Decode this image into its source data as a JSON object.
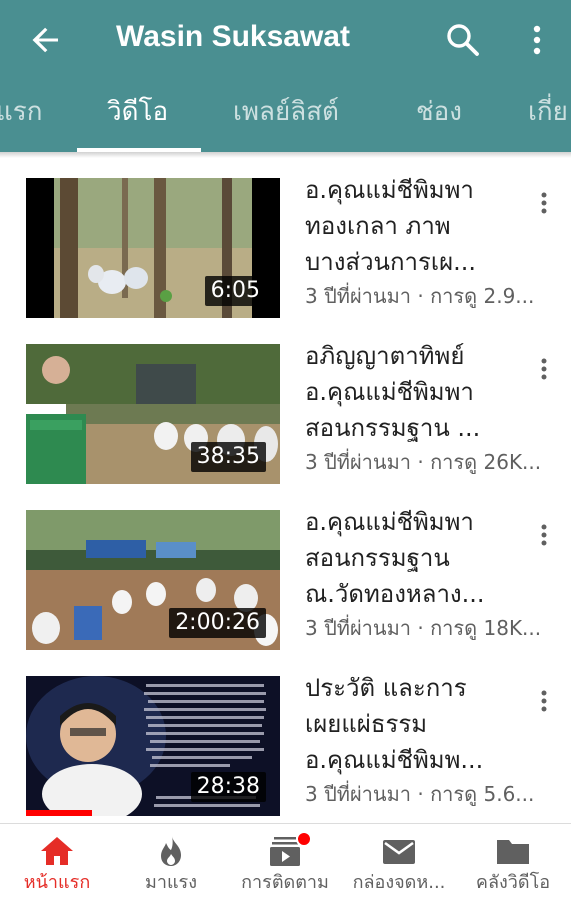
{
  "header": {
    "title": "Wasin Suksawat",
    "background": "#4a8f91",
    "tabs": [
      {
        "label": "แรก"
      },
      {
        "label": "วิดีโอ",
        "active": true
      },
      {
        "label": "เพลย์ลิสต์"
      },
      {
        "label": "ช่อง"
      },
      {
        "label": "เกี่ย"
      }
    ]
  },
  "videos": [
    {
      "title_lines": [
        "อ.คุณแม่ชีพิมพา",
        "ทองเกลา ภาพ",
        "บางส่วนการเผ..."
      ],
      "meta": "3 ปีที่ผ่านมา · การดู 2.9...",
      "duration": "6:05"
    },
    {
      "title_lines": [
        "อภิญญาตาทิพย์",
        "อ.คุณแม่ชีพิมพา",
        "สอนกรรมฐาน ..."
      ],
      "meta": "3 ปีที่ผ่านมา · การดู 26K...",
      "duration": "38:35"
    },
    {
      "title_lines": [
        "อ.คุณแม่ชีพิมพา",
        "สอนกรรมฐาน",
        "ณ.วัดทองหลาง..."
      ],
      "meta": "3 ปีที่ผ่านมา · การดู 18K...",
      "duration": "2:00:26"
    },
    {
      "title_lines": [
        "ประวัติ และการ",
        "เผยแผ่ธรรม",
        "อ.คุณแม่ชีพิมพ..."
      ],
      "meta": "3 ปีที่ผ่านมา · การดู 5.6...",
      "duration": "28:38",
      "watched_fraction": 0.26
    }
  ],
  "bottom_nav": [
    {
      "label": "หน้าแรก",
      "icon": "home-icon",
      "active": true
    },
    {
      "label": "มาแรง",
      "icon": "flame-icon"
    },
    {
      "label": "การติดตาม",
      "icon": "subscriptions-icon",
      "badge": true
    },
    {
      "label": "กล่องจดห...",
      "icon": "mail-icon"
    },
    {
      "label": "คลังวิดีโอ",
      "icon": "folder-icon"
    }
  ],
  "colors": {
    "accent": "#e52d27",
    "progress": "#ff0000"
  }
}
